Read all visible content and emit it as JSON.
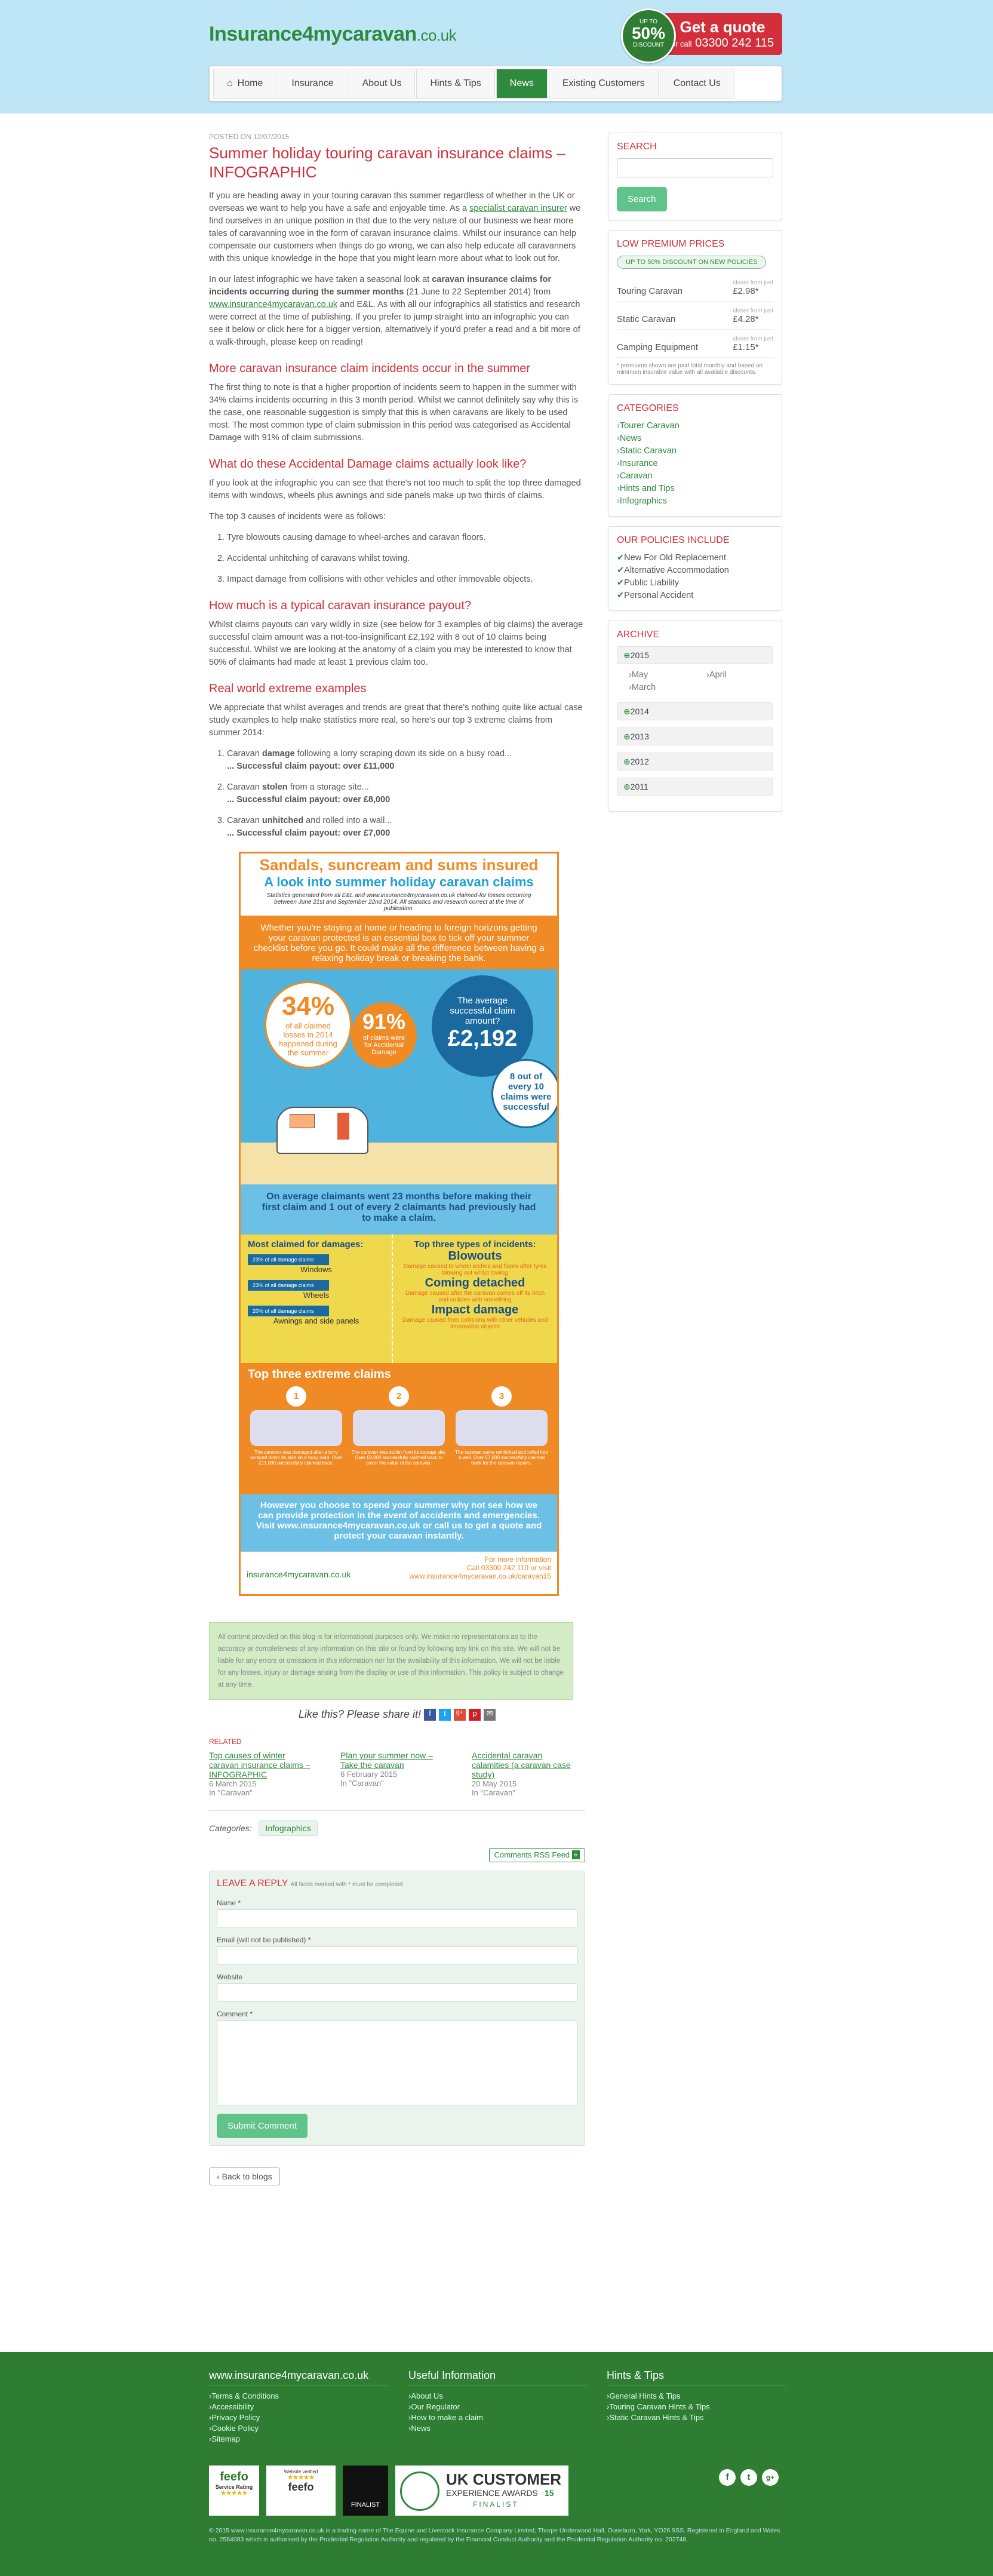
{
  "header": {
    "logo": "Insurance4mycaravan",
    "logo_domain": ".co.uk",
    "badge_top": "UP TO",
    "badge_value": "50%",
    "badge_bottom": "DISCOUNT",
    "quote_title": "Get a quote",
    "quote_or_call": "or call",
    "quote_phone": "03300 242 115"
  },
  "nav": [
    {
      "label": "Home"
    },
    {
      "label": "Insurance"
    },
    {
      "label": "About Us"
    },
    {
      "label": "Hints & Tips"
    },
    {
      "label": "News"
    },
    {
      "label": "Existing Customers"
    },
    {
      "label": "Contact Us"
    }
  ],
  "post": {
    "meta": "POSTED ON 12/07/2015",
    "title": "Summer holiday touring caravan insurance claims – INFOGRAPHIC",
    "p1a": "If you are heading away in your touring caravan this summer regardless of whether in the UK or overseas we want to help you have a safe and enjoyable time. As a ",
    "p1_link": "specialist caravan insurer",
    "p1b": " we find ourselves in an unique position in that due to the very nature of our business we hear more tales of caravanning woe in the form of caravan insurance claims. Whilst our insurance can help compensate our customers when things do go wrong, we can also help educate all caravanners with this unique knowledge in the hope that you might learn more about what to look out for.",
    "p2a": "In our latest infographic we have taken a seasonal look at ",
    "p2_bold": "caravan insurance claims for incidents occurring during the summer months",
    "p2b": " (21 June to 22 September 2014) from ",
    "p2_link": "www.insurance4mycaravan.co.uk",
    "p2c": " and E&L. As with all our infographics all statistics and research were correct at the time of publishing. If you prefer to jump straight into an infographic you can see it below or click here for a bigger version, alternatively if you'd prefer a read and a bit more of a walk-through, please keep on reading!",
    "h2_1": "More caravan insurance claim incidents occur in the summer",
    "p3": "The first thing to note is that a higher proportion of incidents seem to happen in the summer with 34% claims incidents occurring in this 3 month period. Whilst we cannot definitely say why this is the case, one reasonable suggestion is simply that this is when caravans are likely to be used most. The most common type of claim submission in this period was categorised as Accidental Damage with 91% of claim submissions.",
    "h2_2": "What do these Accidental Damage claims actually look like?",
    "p4": "If you look at the infographic you can see that there's not too much to split the top three damaged items with windows, wheels plus awnings and side panels make up two thirds of claims.",
    "p5": "The top 3 causes of incidents were as follows:",
    "causes": [
      "Tyre blowouts causing damage to wheel-arches and caravan floors.",
      "Accidental unhitching of caravans whilst towing.",
      "Impact damage from collisions with other vehicles and other immovable objects."
    ],
    "h2_3": "How much is a typical caravan insurance payout?",
    "p6": "Whilst claims payouts can vary wildly in size (see below for 3 examples of big claims) the average successful claim amount was a not-too-insignificant £2,192 with 8 out of 10 claims being successful. Whilst we are looking at the anatomy of a claim you may be interested to know that 50% of claimants had made at least 1 previous claim too.",
    "h2_4": "Real world extreme examples",
    "p7": "We appreciate that whilst averages and trends are great that there's nothing quite like actual case study examples to help make statistics more real, so here's our top 3 extreme claims from summer 2014:",
    "examples": [
      {
        "a": "Caravan ",
        "b": "damage",
        "c": " following a lorry scraping down its side on a busy road...",
        "d": "... Successful claim payout: over £11,000"
      },
      {
        "a": "Caravan ",
        "b": "stolen",
        "c": " from a storage site...",
        "d": "... Successful claim payout: over £8,000"
      },
      {
        "a": "Caravan ",
        "b": "unhitched",
        "c": " and rolled into a wall...",
        "d": "... Successful claim payout: over £7,000"
      }
    ]
  },
  "infographic": {
    "title": "Sandals, suncream and sums insured",
    "subtitle": "A look into summer holiday caravan claims",
    "source": "Statistics generated from all E&L and www.insurance4mycaravan.co.uk claimed-for losses occurring between June 21st and September 22nd 2014. All statistics and research correct at the time of publication.",
    "intro": "Whether you're staying at home or heading to foreign horizons getting your caravan protected is an essential box to tick off your summer checklist before you go. It could make all the difference between having a relaxing holiday break or breaking the bank.",
    "stat1_value": "34%",
    "stat1_text": "of all claimed losses in 2014 happened during the summer",
    "stat2_value": "91%",
    "stat2_text": "of claims were for Accidental Damage",
    "stat3_text": "The average successful claim amount?",
    "stat3_value": "£2,192",
    "stat4_text": "8 out of every 10 claims were successful",
    "months_text": "On average claimants went 23 months before making their first claim and 1 out of every 2 claimants had previously had to make a claim.",
    "most_claimed_title": "Most claimed for damages:",
    "most_claimed": [
      {
        "pct": "23% of all damage claims",
        "label": "Windows"
      },
      {
        "pct": "23% of all damage claims",
        "label": "Wheels"
      },
      {
        "pct": "20% of all damage claims",
        "label": "Awnings and side panels"
      }
    ],
    "incidents_title": "Top three types of incidents:",
    "incidents": [
      {
        "name": "Blowouts",
        "desc": "Damage caused to wheel arches and floors after tyres blowing out whilst towing"
      },
      {
        "name": "Coming detached",
        "desc": "Damage caused after the caravan comes off its hitch and collides with something"
      },
      {
        "name": "Impact damage",
        "desc": "Damage caused from collisions with other vehicles and immovable objects"
      }
    ],
    "extreme_title": "Top three extreme claims",
    "extreme": [
      {
        "n": "1",
        "text": "The caravan was damaged after a lorry scraped down its side on a busy road. Over £11,000 successfully claimed back."
      },
      {
        "n": "2",
        "text": "The caravan was stolen from its storage site. Over £8,000 successfully claimed back to cover the value of the caravan."
      },
      {
        "n": "3",
        "text": "The caravan came unhitched and rolled into a wall. Over £7,000 successfully claimed back for the caravan repairs."
      }
    ],
    "closing": "However you choose to spend your summer why not see how we can provide protection in the event of accidents and emergencies. Visit www.insurance4mycaravan.co.uk or call us to get a quote and protect your caravan instantly.",
    "more_info": "For more information",
    "more_call": "Call 03300 242 110 or visit",
    "more_url": "www.insurance4mycaravan.co.uk/caravan15",
    "footer_logo": "insurance4mycaravan.co.uk"
  },
  "disclaimer": "All content provided on this blog is for informational purposes only. We make no representations as to the accuracy or completeness of any information on this site or found by following any link on this site. We will not be liable for any errors or omissions in this information nor for the availability of this information. We will not be liable for any losses, injury or damage arising from the display or use of this information. This policy is subject to change at any time.",
  "share": "Like this? Please share it!",
  "related_title": "RELATED",
  "related": [
    {
      "title": "Top causes of winter caravan insurance claims – INFOGRAPHIC",
      "date": "6 March 2015",
      "cat": "In \"Caravan\""
    },
    {
      "title": "Plan your summer now – Take the caravan",
      "date": "6 February 2015",
      "cat": "In \"Caravan\""
    },
    {
      "title": "Accidental caravan calamities (a caravan case study)",
      "date": "20 May 2015",
      "cat": "In \"Caravan\""
    }
  ],
  "categories_label": "Categories:",
  "category_tag": "Infographics",
  "rss": "Comments RSS Feed",
  "reply": {
    "title": "LEAVE A REPLY",
    "note": "All fields marked with * must be completed",
    "name": "Name *",
    "email": "Email (will not be published) *",
    "website": "Website",
    "comment": "Comment *",
    "submit": "Submit Comment"
  },
  "back": "Back to blogs",
  "sidebar": {
    "search_title": "SEARCH",
    "search_btn": "Search",
    "premium_title": "LOW PREMIUM PRICES",
    "premium_chip": "UP TO 50% DISCOUNT ON NEW POLICIES",
    "prices": [
      {
        "name": "Touring Caravan",
        "from": "closer from just",
        "price": "£2.98*"
      },
      {
        "name": "Static Caravan",
        "from": "closer from just",
        "price": "£4.28*"
      },
      {
        "name": "Camping Equipment",
        "from": "closer from just",
        "price": "£1.15*"
      }
    ],
    "price_note": "* premiums shown are paid total monthly and based on minimum insurable value with all available discounts.",
    "categories_title": "CATEGORIES",
    "categories": [
      "Tourer Caravan",
      "News",
      "Static Caravan",
      "Insurance",
      "Caravan",
      "Hints and Tips",
      "Infographics"
    ],
    "policies_title": "OUR POLICIES INCLUDE",
    "policies": [
      "New For Old Replacement",
      "Alternative Accommodation",
      "Public Liability",
      "Personal Accident"
    ],
    "archive_title": "ARCHIVE",
    "archive": {
      "year": "2015",
      "months_left": [
        "May",
        "March"
      ],
      "months_right": [
        "April"
      ],
      "others": [
        "2014",
        "2013",
        "2012",
        "2011"
      ]
    }
  },
  "footer": {
    "col1_title": "www.insurance4mycaravan.co.uk",
    "col1": [
      "Terms & Conditions",
      "Accessibility",
      "Privacy Policy",
      "Cookie Policy",
      "Sitemap"
    ],
    "col2_title": "Useful Information",
    "col2": [
      "About Us",
      "Our Regulator",
      "How to make a claim",
      "News"
    ],
    "col3_title": "Hints & Tips",
    "col3": [
      "General Hints & Tips",
      "Touring Caravan Hints & Tips",
      "Static Caravan Hints & Tips"
    ],
    "feefo1": "feefo",
    "feefo1_sub": "Service Rating",
    "feefo2_top": "Website verified",
    "feefo2": "feefo",
    "finalist_label": "FINALIST",
    "ukcx_line1": "UK CUSTOMER",
    "ukcx_line2": "EXPERIENCE AWARDS",
    "ukcx_year": "15",
    "ukcx_finalist": "FINALIST",
    "legal": "© 2015 www.insurance4mycaravan.co.uk is a trading name of The Equine and Livestock Insurance Company Limited, Thorpe Underwood Hall, Ouseburn, York, YO26 9SS. Registered in England and Wales no. 2584083 which is authorised by the Prudential Regulation Authority and regulated by the Financial Conduct Authority and the Prudential Regulation Authority no. 202748."
  }
}
